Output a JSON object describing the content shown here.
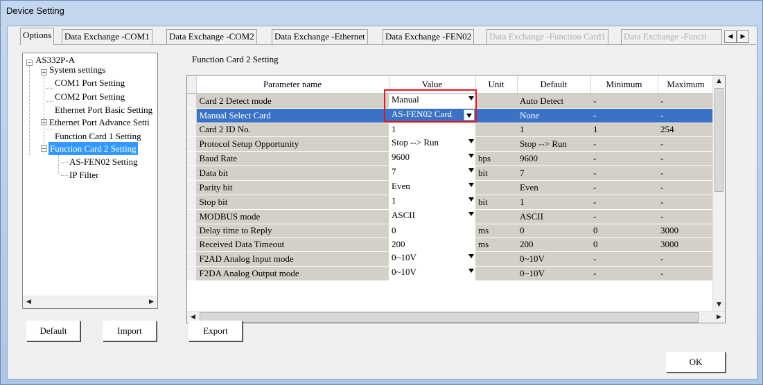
{
  "window": {
    "title": "Device Setting"
  },
  "tabs": [
    {
      "label": "Options",
      "state": "active"
    },
    {
      "label": "Data Exchange -COM1",
      "state": "normal"
    },
    {
      "label": "Data Exchange -COM2",
      "state": "normal"
    },
    {
      "label": "Data Exchange -Ethernet",
      "state": "normal"
    },
    {
      "label": "Data Exchange -FEN02",
      "state": "normal"
    },
    {
      "label": "Data Exchange -Function Card1",
      "state": "disabled"
    },
    {
      "label": "Data Exchange -Functi",
      "state": "disabled"
    }
  ],
  "tree": {
    "root": "AS332P-A",
    "items": [
      "System settings",
      "COM1 Port Setting",
      "COM2 Port Setting",
      "Ethernet Port Basic Setting",
      "Ethernet Port Advance Setti",
      "Function Card 1 Setting",
      "Function Card 2 Setting"
    ],
    "children": [
      "AS-FEN02 Setting",
      "IP Filter"
    ],
    "selected": "Function Card 2 Setting"
  },
  "panel": {
    "title": "Function Card 2 Setting"
  },
  "grid": {
    "columns": [
      "Parameter name",
      "Value",
      "Unit",
      "Default",
      "Minimum",
      "Maximum"
    ],
    "rows": [
      {
        "name": "Card 2 Detect mode",
        "value": "Manual",
        "unit": "",
        "default": "Auto Detect",
        "min": "-",
        "max": "-",
        "dropdown": true
      },
      {
        "name": "Manual Select Card",
        "value": "AS-FEN02 Card",
        "unit": "",
        "default": "None",
        "min": "-",
        "max": "-",
        "dropdown": true,
        "selected": true
      },
      {
        "name": "Card 2 ID No.",
        "value": "1",
        "unit": "",
        "default": "1",
        "min": "1",
        "max": "254"
      },
      {
        "name": "Protocol Setup Opportunity",
        "value": "Stop --> Run",
        "unit": "",
        "default": "Stop --> Run",
        "min": "-",
        "max": "-",
        "dropdown": true
      },
      {
        "name": "Baud Rate",
        "value": "9600",
        "unit": "bps",
        "default": "9600",
        "min": "-",
        "max": "-",
        "dropdown": true
      },
      {
        "name": "Data bit",
        "value": "7",
        "unit": "bit",
        "default": "7",
        "min": "-",
        "max": "-",
        "dropdown": true
      },
      {
        "name": "Parity bit",
        "value": "Even",
        "unit": "",
        "default": "Even",
        "min": "-",
        "max": "-",
        "dropdown": true
      },
      {
        "name": "Stop bit",
        "value": "1",
        "unit": "bit",
        "default": "1",
        "min": "-",
        "max": "-",
        "dropdown": true
      },
      {
        "name": "MODBUS mode",
        "value": "ASCII",
        "unit": "",
        "default": "ASCII",
        "min": "-",
        "max": "-",
        "dropdown": true
      },
      {
        "name": "Delay time to Reply",
        "value": "0",
        "unit": "ms",
        "default": "0",
        "min": "0",
        "max": "3000"
      },
      {
        "name": "Received Data Timeout",
        "value": "200",
        "unit": "ms",
        "default": "200",
        "min": "0",
        "max": "3000"
      },
      {
        "name": "F2AD Analog Input mode",
        "value": "0~10V",
        "unit": "",
        "default": "0~10V",
        "min": "-",
        "max": "-",
        "dropdown": true
      },
      {
        "name": "F2DA Analog Output mode",
        "value": "0~10V",
        "unit": "",
        "default": "0~10V",
        "min": "-",
        "max": "-",
        "dropdown": true
      }
    ]
  },
  "buttons": {
    "default": "Default",
    "import": "Import",
    "export": "Export",
    "ok": "OK"
  }
}
